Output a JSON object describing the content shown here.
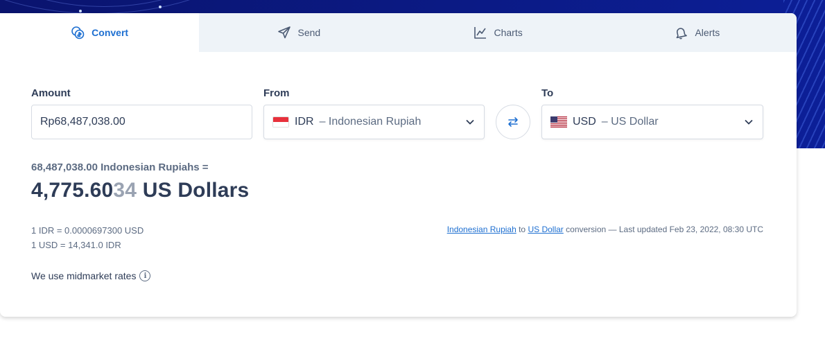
{
  "tabs": [
    {
      "label": "Convert",
      "icon": "coins-icon",
      "active": true
    },
    {
      "label": "Send",
      "icon": "send-icon",
      "active": false
    },
    {
      "label": "Charts",
      "icon": "chart-icon",
      "active": false
    },
    {
      "label": "Alerts",
      "icon": "bell-icon",
      "active": false
    }
  ],
  "form": {
    "amount_label": "Amount",
    "amount_value": "Rp68,487,038.00",
    "from_label": "From",
    "from_code": "IDR",
    "from_name": "– Indonesian Rupiah",
    "to_label": "To",
    "to_code": "USD",
    "to_name": "– US Dollar"
  },
  "result": {
    "from_text": "68,487,038.00 Indonesian Rupiahs =",
    "to_main": "4,775.60",
    "to_faded": "34",
    "to_unit": " US Dollars"
  },
  "rates": {
    "line1": "1 IDR = 0.0000697300 USD",
    "line2": "1 USD = 14,341.0 IDR"
  },
  "updated": {
    "link1": "Indonesian Rupiah",
    "to_word": " to ",
    "link2": "US Dollar",
    "suffix": " conversion — Last updated Feb 23, 2022, 08:30 UTC"
  },
  "midmarket_text": "We use midmarket rates",
  "colors": {
    "accent": "#1d6fd1",
    "hero_bg": "#0b1a85",
    "text": "#2e3c57"
  }
}
